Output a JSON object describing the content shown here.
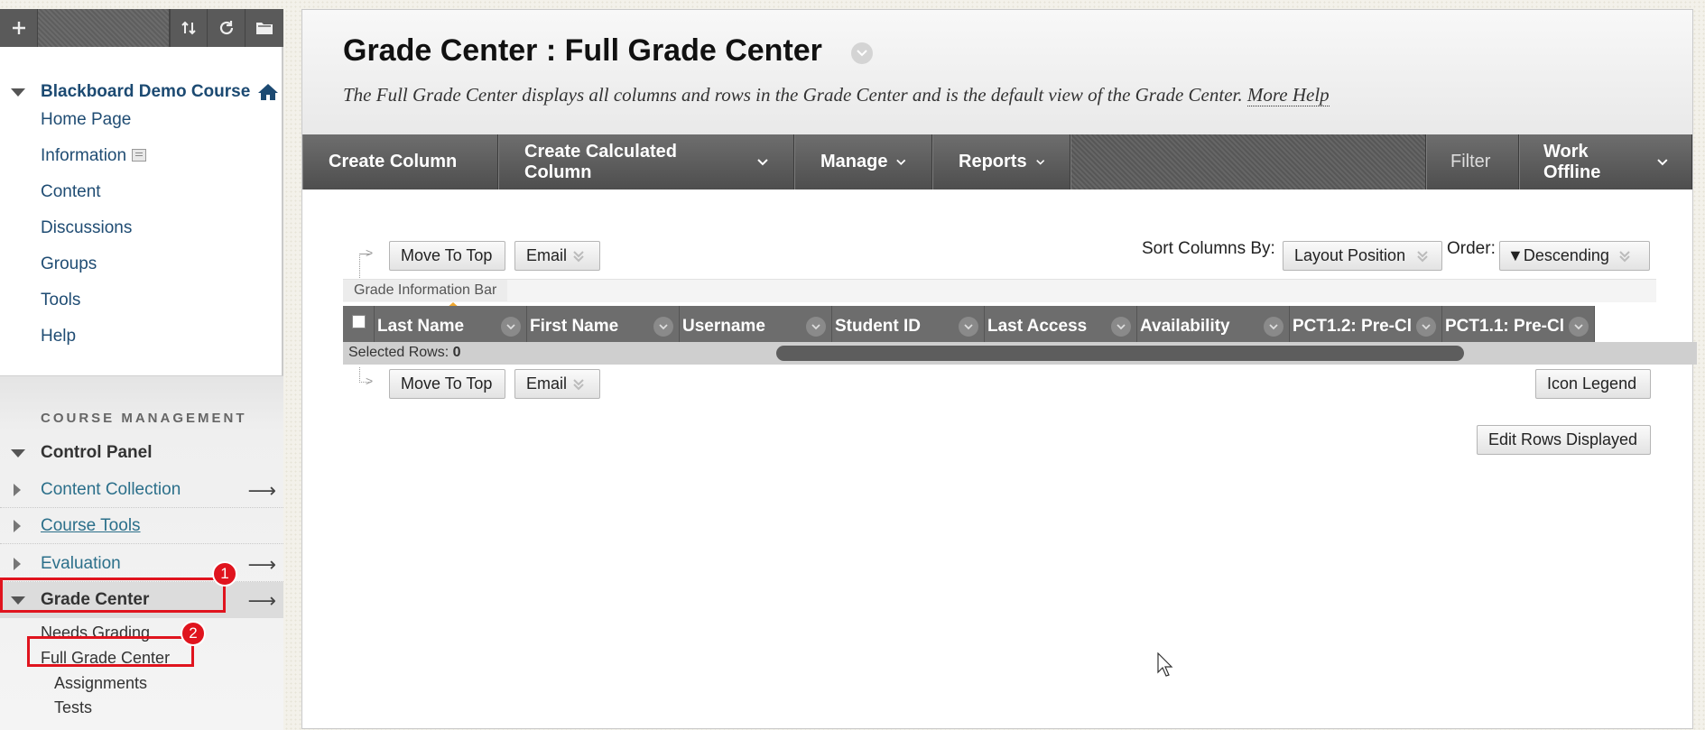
{
  "sidebar": {
    "course_title": "Blackboard Demo Course",
    "links": [
      "Home Page",
      "Information",
      "Content",
      "Discussions",
      "Groups",
      "Tools",
      "Help"
    ],
    "course_management_heading": "COURSE MANAGEMENT",
    "control_panel": "Control Panel",
    "content_collection": "Content Collection",
    "course_tools": "Course Tools",
    "evaluation": "Evaluation",
    "grade_center": "Grade Center",
    "grade_center_items": [
      "Needs Grading",
      "Full Grade Center",
      "Assignments",
      "Tests"
    ],
    "arrow_glyph": "⟶"
  },
  "annotations": {
    "badge1": "1",
    "badge2": "2",
    "color": "#e0141e"
  },
  "page": {
    "title": "Grade Center : Full Grade Center",
    "description": "The Full Grade Center displays all columns and rows in the Grade Center and is the default view of the Grade Center.",
    "more_help": "More Help"
  },
  "action_bar": {
    "create_column": "Create Column",
    "create_calculated_column": "Create Calculated Column",
    "manage": "Manage",
    "reports": "Reports",
    "filter": "Filter",
    "work_offline": "Work Offline"
  },
  "toolbar": {
    "move_to_top": "Move To Top",
    "email": "Email",
    "sort_columns_by_label": "Sort Columns By:",
    "sort_columns_by_value": "Layout Position",
    "order_label": "Order:",
    "order_value": "▼Descending",
    "icon_legend": "Icon Legend",
    "edit_rows_displayed": "Edit Rows Displayed"
  },
  "grid": {
    "info_bar_label": "Grade Information Bar",
    "columns": [
      "Last Name",
      "First Name",
      "Username",
      "Student ID",
      "Last Access",
      "Availability",
      "PCT1.2: Pre-Cl",
      "PCT1.1: Pre-Cl"
    ],
    "selected_rows_label": "Selected Rows:",
    "selected_rows_count": "0"
  }
}
